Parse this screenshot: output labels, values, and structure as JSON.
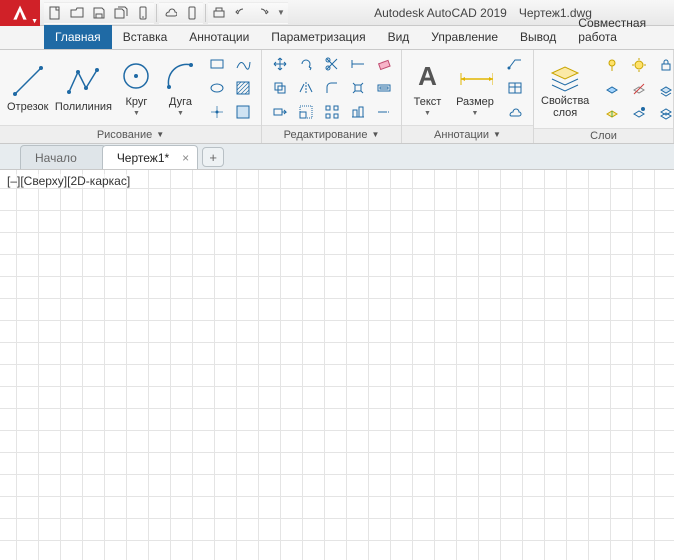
{
  "title": {
    "app": "Autodesk AutoCAD 2019",
    "file": "Чертеж1.dwg"
  },
  "tabs": {
    "items": [
      "Главная",
      "Вставка",
      "Аннотации",
      "Параметризация",
      "Вид",
      "Управление",
      "Вывод",
      "Совместная работа"
    ],
    "active_index": 0
  },
  "ribbon": {
    "draw": {
      "title": "Рисование",
      "line": "Отрезок",
      "polyline": "Полилиния",
      "circle": "Круг",
      "arc": "Дуга"
    },
    "modify": {
      "title": "Редактирование"
    },
    "annotation": {
      "title": "Аннотации",
      "text": "Текст",
      "dimension": "Размер"
    },
    "layers": {
      "title": "Слои",
      "props": "Свойства\nслоя"
    }
  },
  "doctabs": {
    "items": [
      {
        "label": "Начало",
        "closable": false,
        "active": false
      },
      {
        "label": "Чертеж1*",
        "closable": true,
        "active": true
      }
    ]
  },
  "viewport": {
    "controls": "[–][Сверху][2D-каркас]"
  }
}
